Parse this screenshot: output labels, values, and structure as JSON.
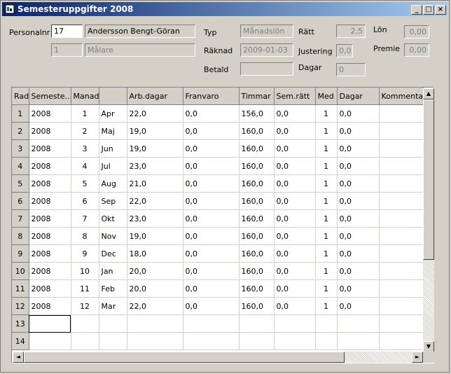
{
  "window": {
    "title": "Semesteruppgifter 2008"
  },
  "form": {
    "personalnr_label": "Personalnr",
    "personalnr_value": "17",
    "name_value": "Andersson Bengt-Göran",
    "sub_num_value": "1",
    "title_value": "Målare",
    "typ_label": "Typ",
    "typ_value": "Månadslön",
    "raknad_label": "Räknad",
    "raknad_value": "2009-01-03",
    "betald_label": "Betald",
    "betald_value": "",
    "ratt_label": "Rätt",
    "ratt_value": "2,5",
    "justering_label": "Justering",
    "justering_value": "0,0",
    "dagar_label": "Dagar",
    "dagar_value": "0",
    "lon_label": "Lön",
    "lon_value": "0,00",
    "premie_label": "Premie",
    "premie_value": "0,00"
  },
  "grid": {
    "columns": [
      "Rad",
      "Semeste...",
      "Manad",
      "",
      "Arb.dagar",
      "Franvaro",
      "Timmar",
      "Sem.rätt",
      "Med",
      "Dagar",
      "Kommentar"
    ],
    "rows": [
      [
        "1",
        "2008",
        "1",
        "Apr",
        "22,0",
        "0,0",
        "156,0",
        "0,0",
        "1",
        "0,0",
        ""
      ],
      [
        "2",
        "2008",
        "2",
        "Maj",
        "19,0",
        "0,0",
        "160,0",
        "0,0",
        "1",
        "0,0",
        ""
      ],
      [
        "3",
        "2008",
        "3",
        "Jun",
        "19,0",
        "0,0",
        "160,0",
        "0,0",
        "1",
        "0,0",
        ""
      ],
      [
        "4",
        "2008",
        "4",
        "Jul",
        "23,0",
        "0,0",
        "160,0",
        "0,0",
        "1",
        "0,0",
        ""
      ],
      [
        "5",
        "2008",
        "5",
        "Aug",
        "21,0",
        "0,0",
        "160,0",
        "0,0",
        "1",
        "0,0",
        ""
      ],
      [
        "6",
        "2008",
        "6",
        "Sep",
        "22,0",
        "0,0",
        "160,0",
        "0,0",
        "1",
        "0,0",
        ""
      ],
      [
        "7",
        "2008",
        "7",
        "Okt",
        "23,0",
        "0,0",
        "160,0",
        "0,0",
        "1",
        "0,0",
        ""
      ],
      [
        "8",
        "2008",
        "8",
        "Nov",
        "19,0",
        "0,0",
        "160,0",
        "0,0",
        "1",
        "0,0",
        ""
      ],
      [
        "9",
        "2008",
        "9",
        "Dec",
        "18,0",
        "0,0",
        "160,0",
        "0,0",
        "1",
        "0,0",
        ""
      ],
      [
        "10",
        "2008",
        "10",
        "Jan",
        "20,0",
        "0,0",
        "160,0",
        "0,0",
        "1",
        "0,0",
        ""
      ],
      [
        "11",
        "2008",
        "11",
        "Feb",
        "20,0",
        "0,0",
        "160,0",
        "0,0",
        "1",
        "0,0",
        ""
      ],
      [
        "12",
        "2008",
        "12",
        "Mar",
        "22,0",
        "0,0",
        "160,0",
        "0,0",
        "1",
        "0,0",
        ""
      ],
      [
        "13",
        "",
        "",
        "",
        "",
        "",
        "",
        "",
        "",
        "",
        ""
      ],
      [
        "14",
        "",
        "",
        "",
        "",
        "",
        "",
        "",
        "",
        "",
        ""
      ]
    ]
  },
  "icons": {
    "window_icon": "app-icon",
    "minimize": "minimize-icon",
    "maximize": "maximize-icon",
    "close": "close-icon"
  },
  "colors": {
    "title_start": "#0a246a",
    "title_end": "#a6caf0",
    "face": "#d4d0c8"
  }
}
